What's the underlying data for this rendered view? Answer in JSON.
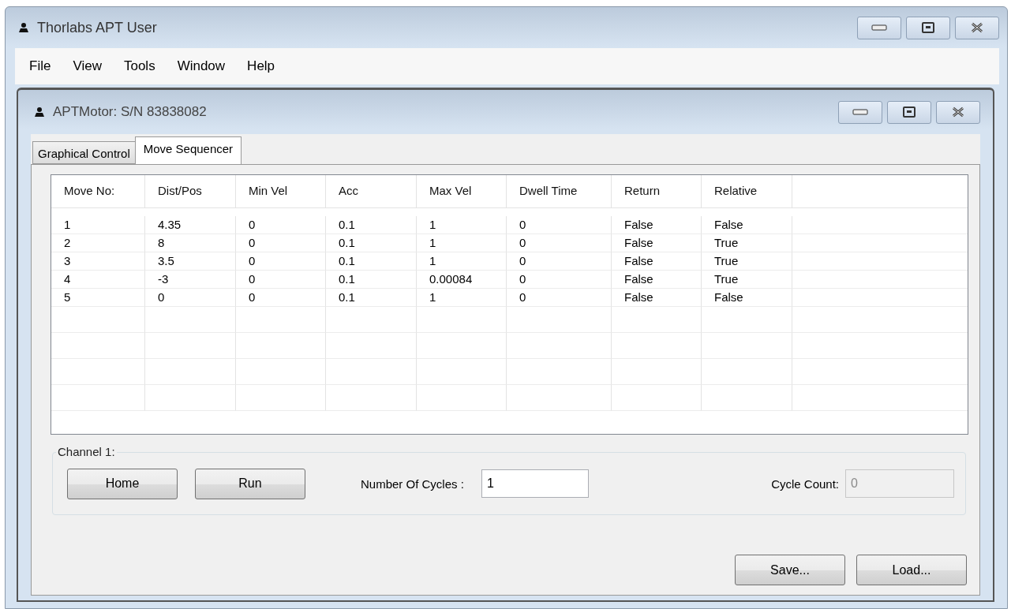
{
  "window": {
    "title": "Thorlabs APT User"
  },
  "menu": [
    {
      "label": "File"
    },
    {
      "label": "View"
    },
    {
      "label": "Tools"
    },
    {
      "label": "Window"
    },
    {
      "label": "Help"
    }
  ],
  "child_window": {
    "title": "APTMotor: S/N 83838082",
    "tabs": [
      {
        "label": "Graphical Control",
        "selected": false
      },
      {
        "label": "Move Sequencer",
        "selected": true
      }
    ],
    "grid": {
      "columns": [
        "Move No:",
        "Dist/Pos",
        "Min Vel",
        "Acc",
        "Max Vel",
        "Dwell Time",
        "Return",
        "Relative"
      ],
      "rows": [
        [
          "1",
          "4.35",
          "0",
          "0.1",
          "1",
          "0",
          "False",
          "False"
        ],
        [
          "2",
          "8",
          "0",
          "0.1",
          "1",
          "0",
          "False",
          "True"
        ],
        [
          "3",
          "3.5",
          "0",
          "0.1",
          "1",
          "0",
          "False",
          "True"
        ],
        [
          "4",
          "-3",
          "0",
          "0.1",
          "0.00084",
          "0",
          "False",
          "True"
        ],
        [
          "5",
          "0",
          "0",
          "0.1",
          "1",
          "0",
          "False",
          "False"
        ]
      ]
    },
    "channel_group": {
      "title": "Channel 1:",
      "buttons": [
        "Home",
        "Run"
      ],
      "cycles": {
        "label": "Number Of Cycles :",
        "value": "1",
        "disabled": false
      },
      "cycle_count": {
        "label": "Cycle Count:",
        "value": "0",
        "disabled": true
      }
    },
    "buttons": [
      "Save...",
      "Load..."
    ]
  }
}
